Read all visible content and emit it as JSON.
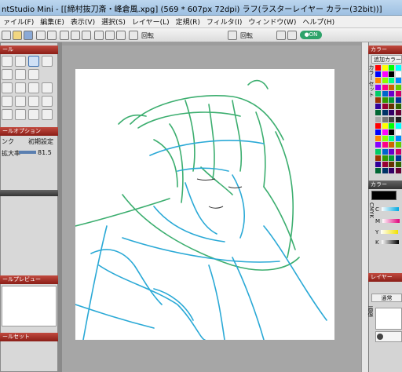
{
  "titlebar": {
    "text": "ntStudio Mini - [[締村抜刀斎・峰倉風.xpg] (569 * 607px 72dpi)  ラフ(ラスターレイヤー カラー(32bit))]"
  },
  "menu": [
    "ァイル(F)",
    "編集(E)",
    "表示(V)",
    "選択(S)",
    "レイヤー(L)",
    "定規(R)",
    "フィルタ(I)",
    "ウィンドウ(W)",
    "ヘルプ(H)"
  ],
  "toolbar": {
    "rotate_label_1": "回転",
    "rotate_label_2": "回転",
    "toggle_label": "●ON"
  },
  "left": {
    "tool_title": "ール",
    "tool_option_title": "ールオプション",
    "option_tab": "ンク",
    "option_reset": "初期設定",
    "zoom_label": "拡大率",
    "zoom_value": "81.5",
    "preview_title": "ールプレビュー",
    "set_title": "ールセット"
  },
  "right": {
    "color_title": "カラー",
    "add_color": "追加カラー",
    "color_set_vertical": "カラーセット",
    "color2_title": "カラー",
    "cmyk_vertical": "CMYK",
    "cmyk_labels": [
      "C",
      "M",
      "Y",
      "K"
    ],
    "layer_title": "レイヤー",
    "blend_mode": "通常",
    "layer_label": "画像"
  },
  "palette_colors": [
    "#ff0000",
    "#ffff00",
    "#00ff00",
    "#00ffff",
    "#0000ff",
    "#ff00ff",
    "#000000",
    "#ffffff"
  ]
}
